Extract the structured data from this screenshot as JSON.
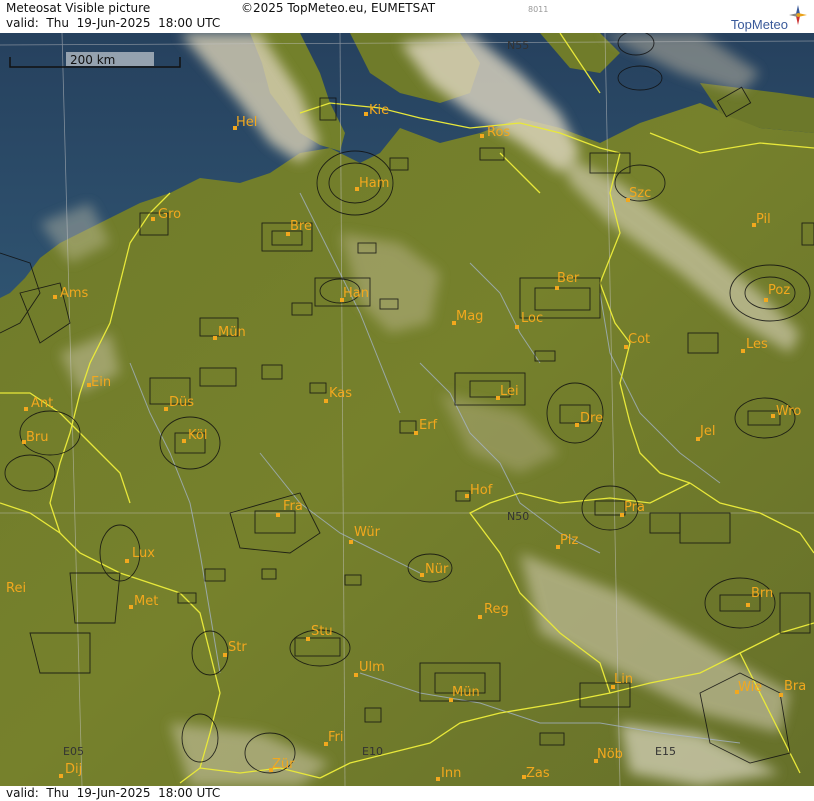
{
  "header": {
    "title": "Meteosat Visible picture",
    "valid": "valid:  Thu  19-Jun-2025  18:00 UTC",
    "copyright": "©2025 TopMeteo.eu, EUMETSAT",
    "code": "8011",
    "brand": "TopMeteo"
  },
  "footer": {
    "valid": "valid:  Thu  19-Jun-2025  18:00 UTC"
  },
  "scale_label": "200 km",
  "grid_labels": {
    "n55": "N55",
    "n50": "N50",
    "e05": "E05",
    "e10": "E10",
    "e15": "E15"
  },
  "cities": {
    "hel": "Hel",
    "kie": "Kie",
    "ros": "Ros",
    "ham": "Ham",
    "szc": "Szc",
    "gro": "Gro",
    "bre": "Bre",
    "pil": "Pil",
    "ber": "Ber",
    "ams": "Ams",
    "han": "Han",
    "poz": "Poz",
    "mag": "Mag",
    "loc": "Loc",
    "mun": "Mün",
    "cot": "Cot",
    "les": "Les",
    "ein": "Ein",
    "kas": "Kas",
    "lei": "Lei",
    "ant": "Ant",
    "dus": "Düs",
    "dre": "Dre",
    "wro": "Wro",
    "erf": "Erf",
    "bru": "Bru",
    "kol": "Köl",
    "jel": "Jel",
    "hof": "Hof",
    "fra": "Fra",
    "pra": "Pra",
    "wur": "Wür",
    "plz": "Plz",
    "lux": "Lux",
    "nur": "Nür",
    "rei": "Rei",
    "met": "Met",
    "reg": "Reg",
    "brn": "Brn",
    "stu": "Stu",
    "str": "Str",
    "ulm": "Ulm",
    "lin": "Lin",
    "mue": "Mün",
    "wie": "Wie",
    "bra": "Bra",
    "fri": "Fri",
    "zur": "Zür",
    "nob": "Nöb",
    "dij": "Dij",
    "inn": "Inn",
    "zas": "Zas"
  },
  "colors": {
    "land": "#6f7a28",
    "sea": "#2b4a66",
    "border": "#e8e83a",
    "city": "#f2a81e"
  }
}
